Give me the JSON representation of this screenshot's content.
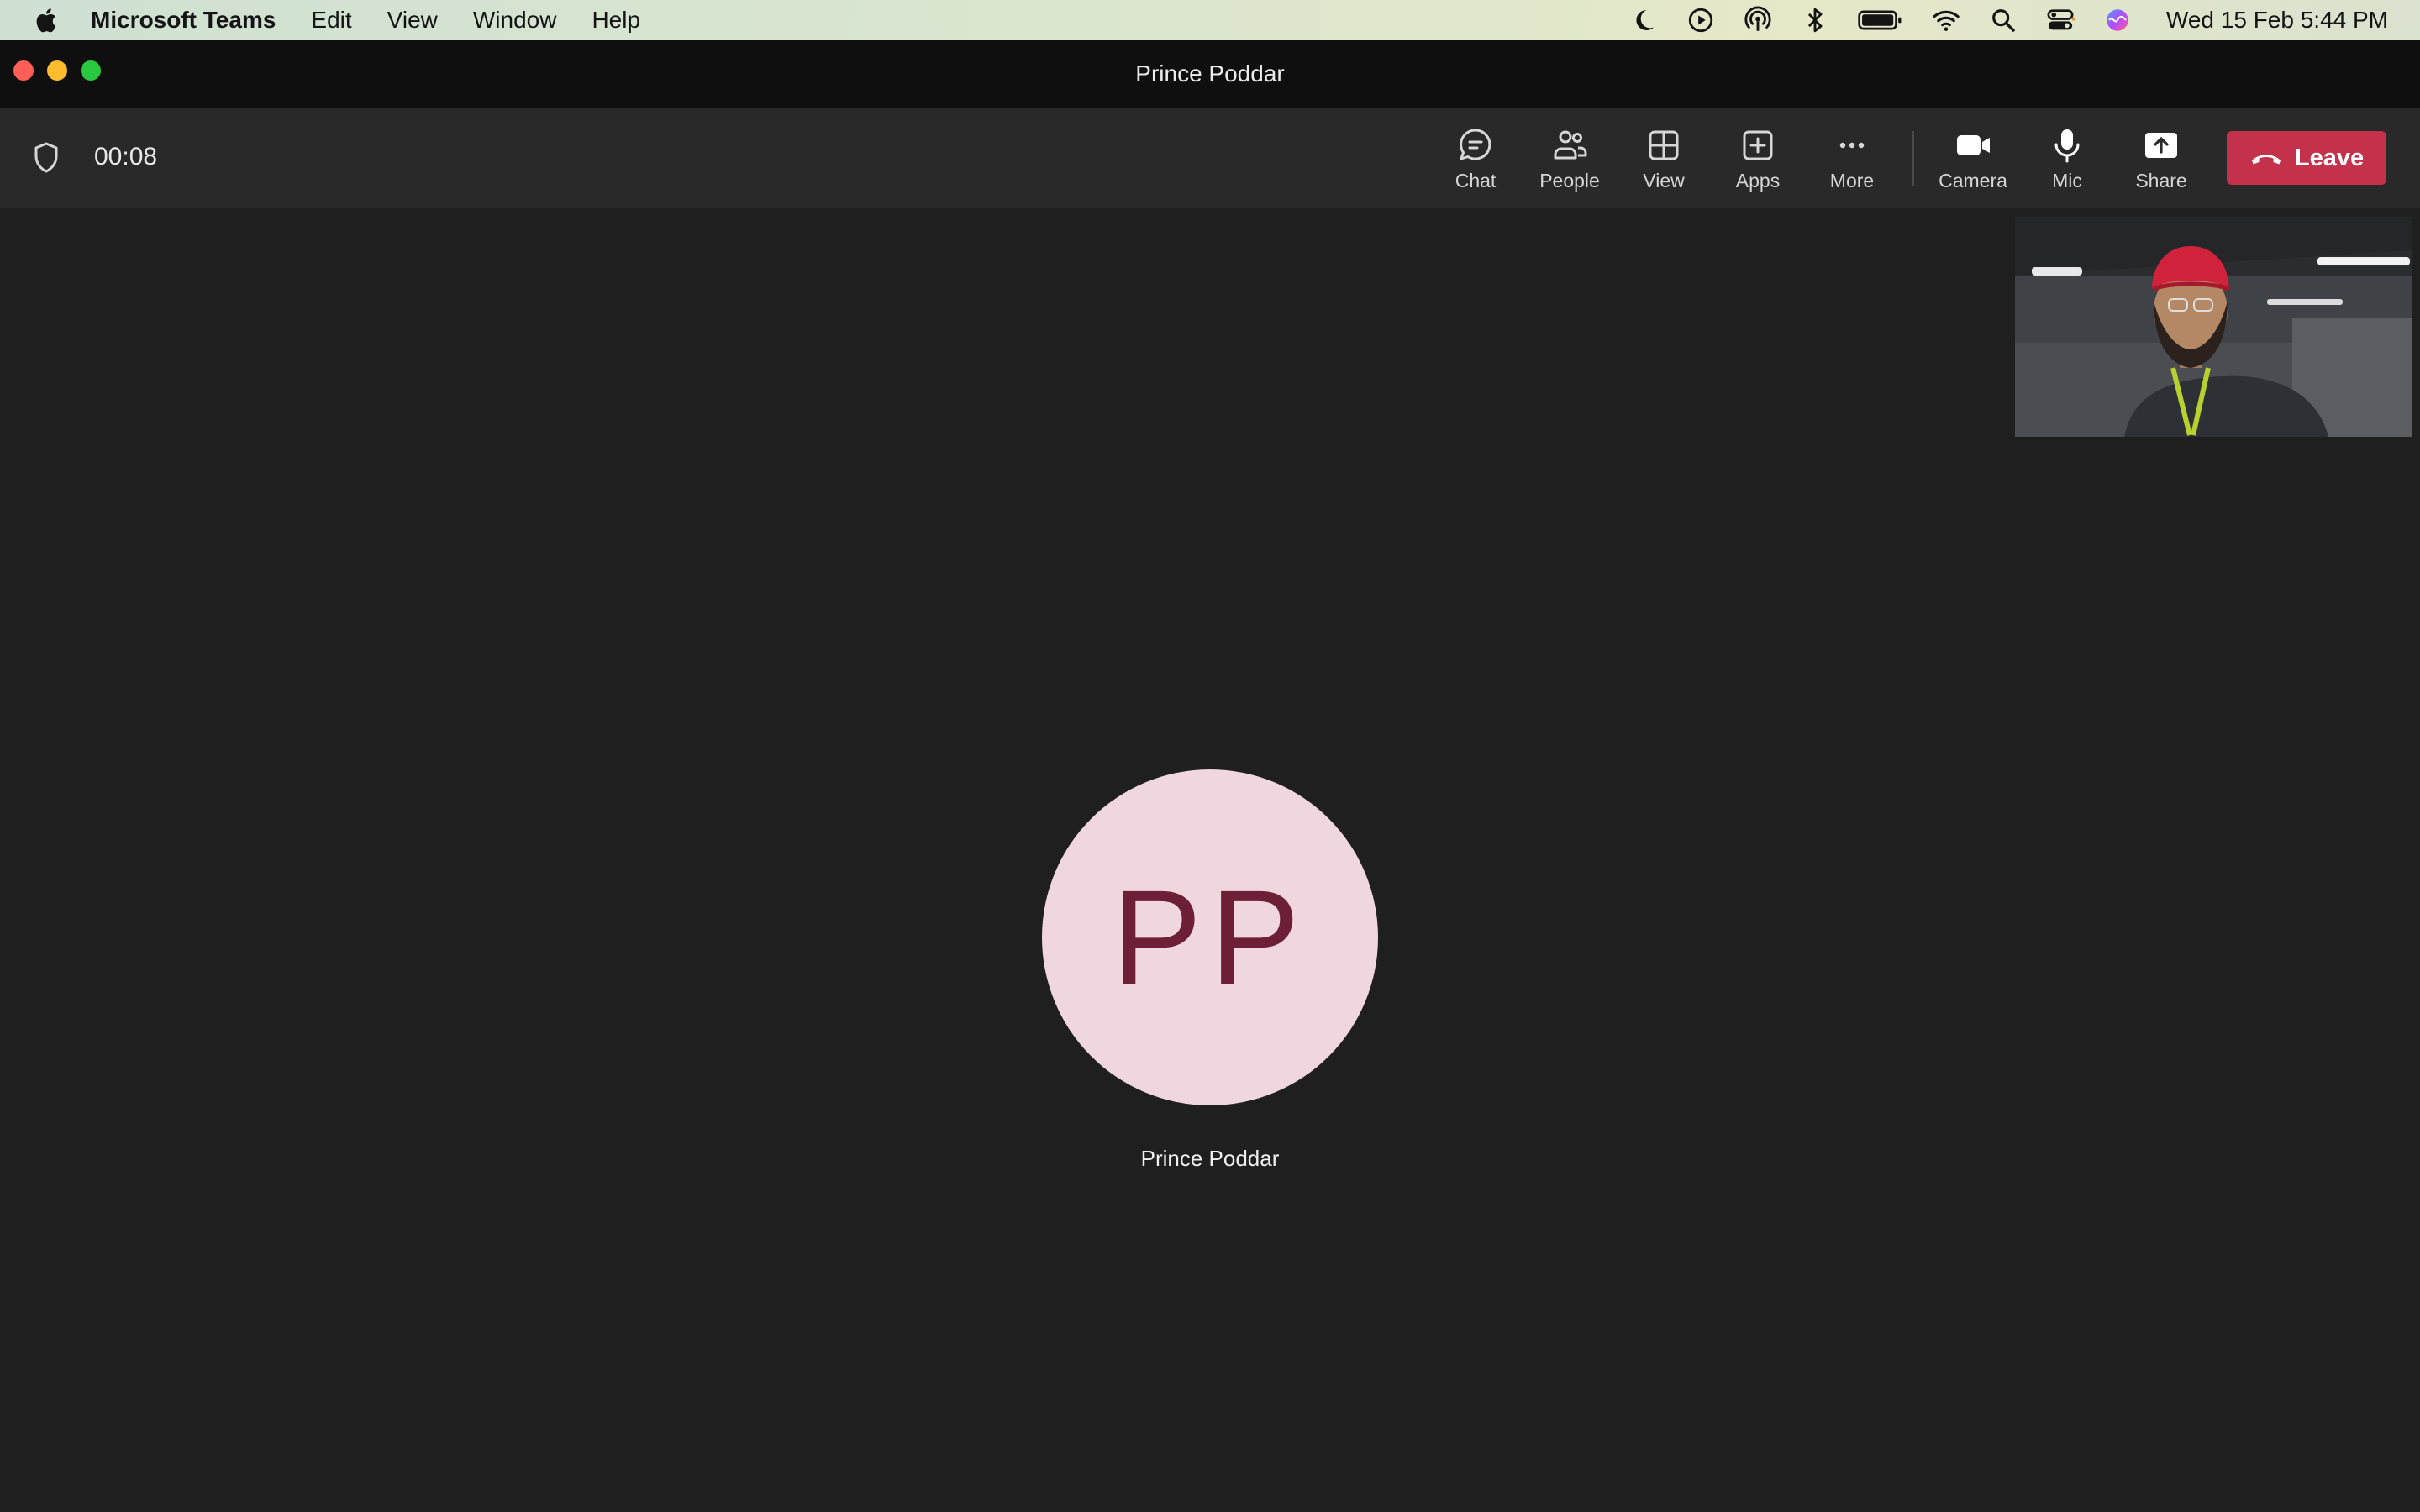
{
  "menubar": {
    "app_name": "Microsoft Teams",
    "items": [
      "Edit",
      "View",
      "Window",
      "Help"
    ],
    "status_icons": [
      "moon-icon",
      "play-circle-icon",
      "airdrop-icon",
      "bluetooth-icon",
      "battery-icon",
      "wifi-icon",
      "spotlight-search-icon",
      "control-center-icon",
      "siri-icon"
    ],
    "clock": "Wed 15 Feb  5:44 PM"
  },
  "window": {
    "title": "Prince Poddar"
  },
  "toolbar": {
    "timer": "00:08",
    "buttons": [
      {
        "label": "Chat",
        "icon": "chat-icon"
      },
      {
        "label": "People",
        "icon": "people-icon"
      },
      {
        "label": "View",
        "icon": "grid-icon"
      },
      {
        "label": "Apps",
        "icon": "add-app-icon"
      },
      {
        "label": "More",
        "icon": "more-icon"
      },
      {
        "label": "Camera",
        "icon": "camera-icon"
      },
      {
        "label": "Mic",
        "icon": "mic-icon"
      },
      {
        "label": "Share",
        "icon": "share-icon"
      }
    ],
    "leave_label": "Leave"
  },
  "participant": {
    "initials": "PP",
    "name": "Prince Poddar"
  },
  "colors": {
    "leave": "#c4314b",
    "avatar_bg": "#f0d6df",
    "avatar_text": "#6e1f38",
    "stage_bg": "#1f1f1f"
  }
}
